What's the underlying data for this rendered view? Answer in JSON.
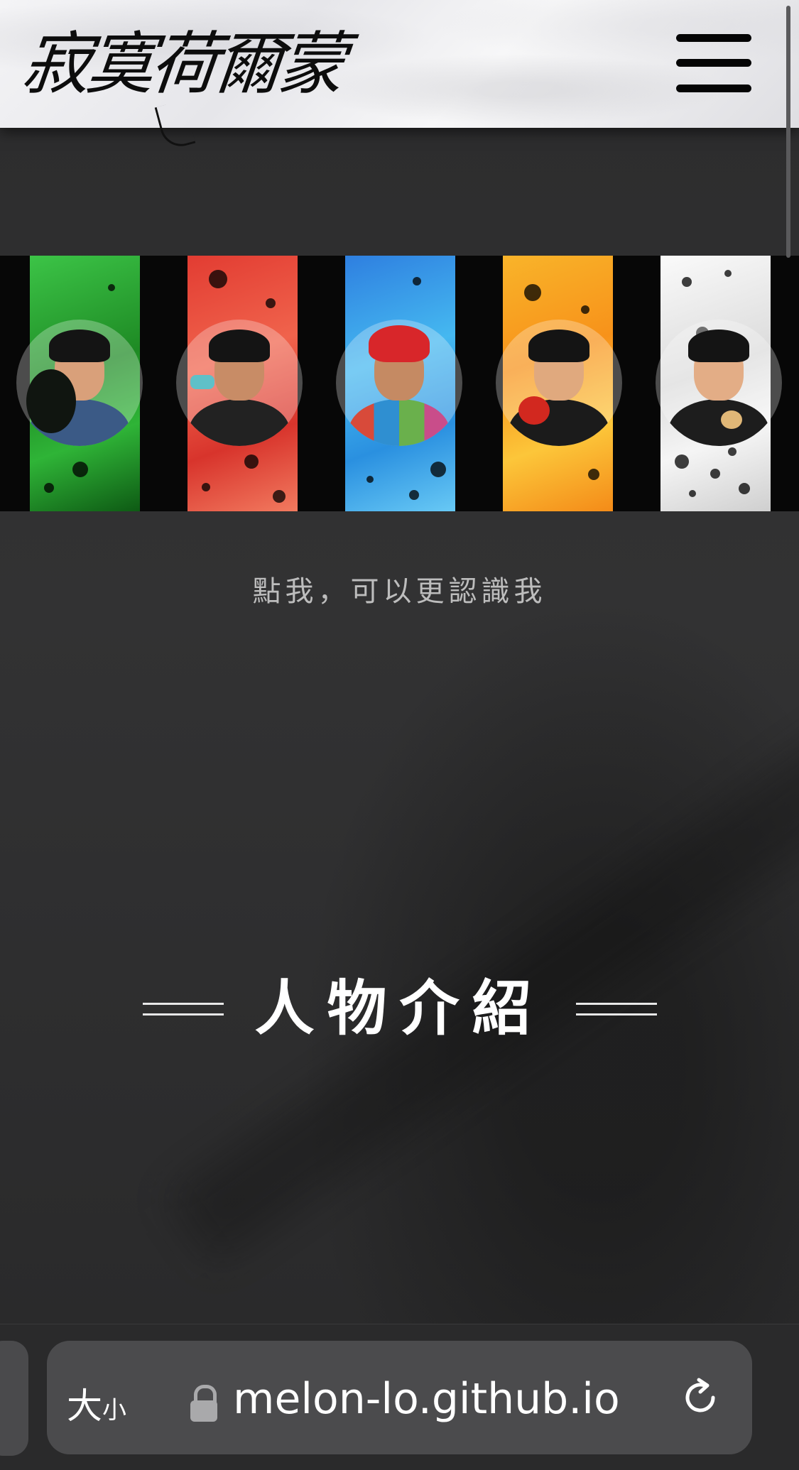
{
  "header": {
    "logo_text": "寂寞荷爾蒙",
    "menu_label": "menu"
  },
  "characters": [
    {
      "name": "character-green",
      "color": "#2fb437",
      "shirt": "#3b5a86"
    },
    {
      "name": "character-red",
      "color": "#e8463a",
      "shirt": "#222222"
    },
    {
      "name": "character-blue",
      "color": "#35a6e8",
      "shirt": "#2f8fd1"
    },
    {
      "name": "character-orange",
      "color": "#f8a81f",
      "shirt": "#1b1b1b"
    },
    {
      "name": "character-white",
      "color": "#ececec",
      "shirt": "#1d1d1d"
    }
  ],
  "tagline": "點我，可以更認識我",
  "section": {
    "title": "人物介紹"
  },
  "browser": {
    "size_label_big": "大",
    "size_label_small": "小",
    "url": "melon-lo.github.io",
    "lock_icon": "lock-icon",
    "reload_icon": "reload-icon"
  }
}
